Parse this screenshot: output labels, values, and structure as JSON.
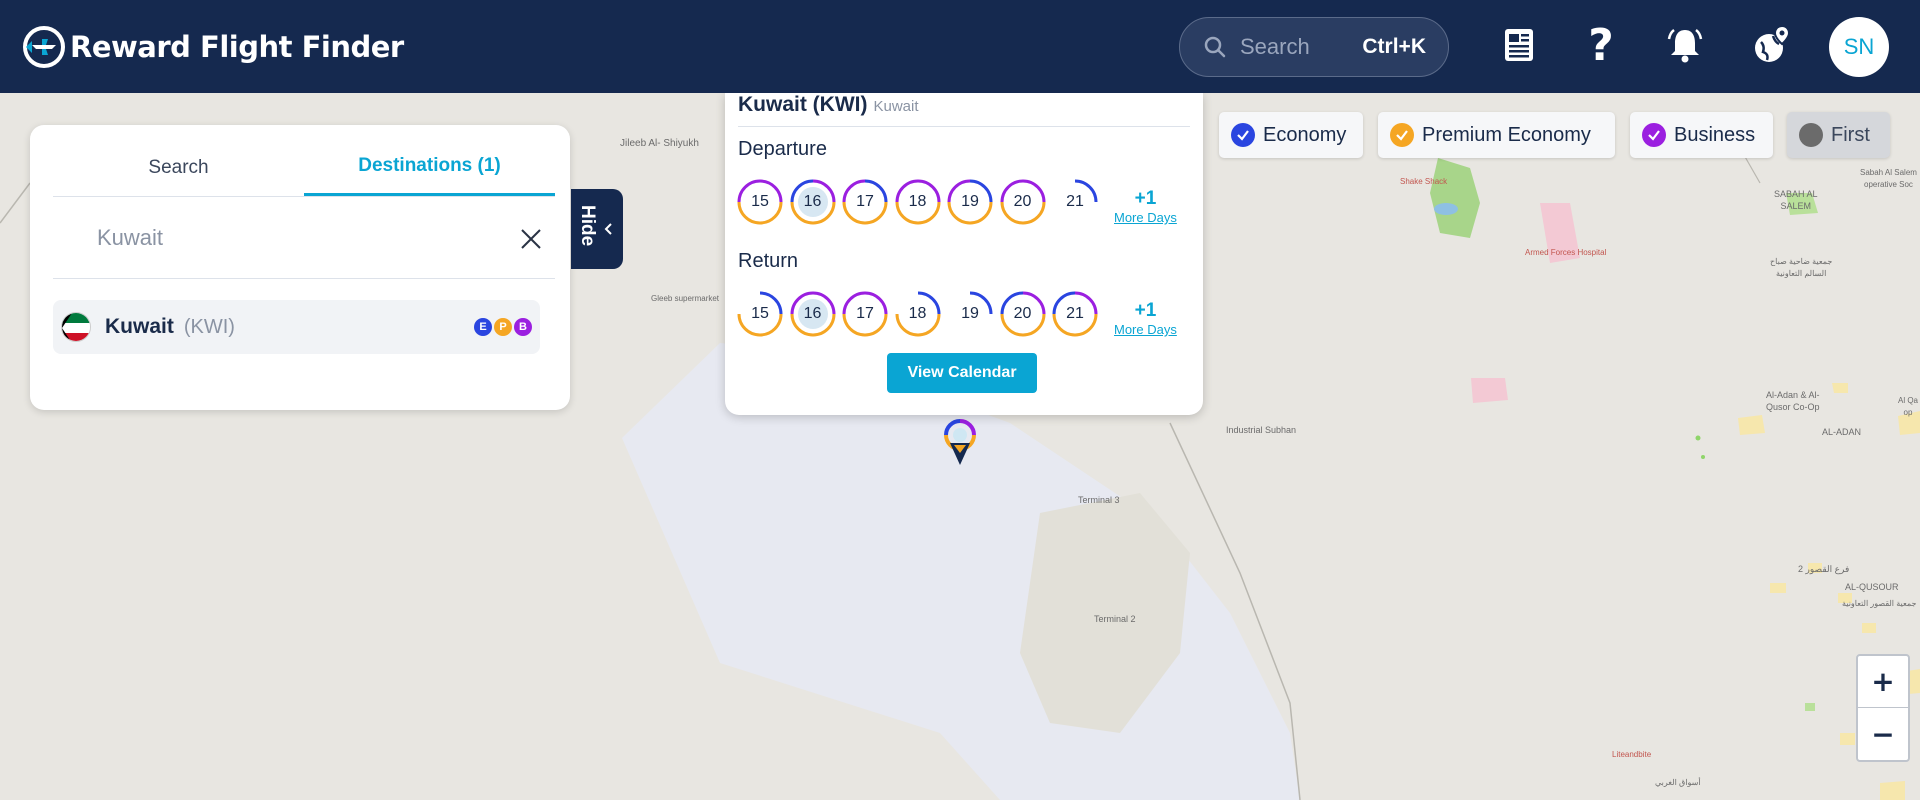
{
  "header": {
    "brand": "Reward Flight Finder",
    "search_placeholder": "Search",
    "search_shortcut": "Ctrl+K",
    "avatar_initials": "SN"
  },
  "panel": {
    "tabs": [
      {
        "label": "Search",
        "active": false
      },
      {
        "label": "Destinations (1)",
        "active": true
      }
    ],
    "destination_input": "Kuwait",
    "results": [
      {
        "city": "Kuwait",
        "code": "(KWI)",
        "cabins": [
          "E",
          "P",
          "B"
        ]
      }
    ],
    "hide_label": "Hide"
  },
  "popup": {
    "title": "Kuwait (KWI)",
    "subtitle": "Kuwait",
    "departure_label": "Departure",
    "return_label": "Return",
    "departure_days": [
      "15",
      "16",
      "17",
      "18",
      "19",
      "20",
      "21"
    ],
    "return_days": [
      "15",
      "16",
      "17",
      "18",
      "19",
      "20",
      "21"
    ],
    "more_count": "+1",
    "more_label": "More Days",
    "view_calendar": "View Calendar"
  },
  "filters": [
    {
      "label": "Economy",
      "color": "#2a45e0",
      "checked": true
    },
    {
      "label": "Premium Economy",
      "color": "#f5a623",
      "checked": true
    },
    {
      "label": "Business",
      "color": "#9b1fe0",
      "checked": true
    },
    {
      "label": "First",
      "color": "#6b6b6b",
      "checked": false
    }
  ],
  "map_labels": {
    "jileeb": "Jileeb Al-\nShiyukh",
    "gleeb": "Gleeb supermarket",
    "shake": "Shake Shack",
    "armed": "Armed Forces Hospital",
    "sabah": "SABAH AL\nSALEM",
    "sabah2": "Sabah Al Salem\noperative Soc",
    "coop": "جمعية ضاحية صباح\nالسالم التعاونية",
    "subhan": "Industrial Subhan",
    "t3": "Terminal 3",
    "t2": "Terminal 2",
    "aladan_coop": "Al-Adan & Al-\nQusor Co-Op",
    "aladan": "AL-ADAN",
    "alqa": "Al Qa\nop",
    "qusour2": "فرع القصور 2",
    "alqusour": "AL-QUSOUR",
    "qusour_coop": "جمعية القصور التعاونية",
    "liteandbite": "Liteandbite",
    "souq": "أسواق الغربي"
  },
  "zoom": {
    "in": "+",
    "out": "−"
  },
  "colors": {
    "header": "#15294f",
    "accent": "#0aa5d3",
    "economy": "#2a45e0",
    "premium": "#f5a623",
    "business": "#9b1fe0"
  }
}
